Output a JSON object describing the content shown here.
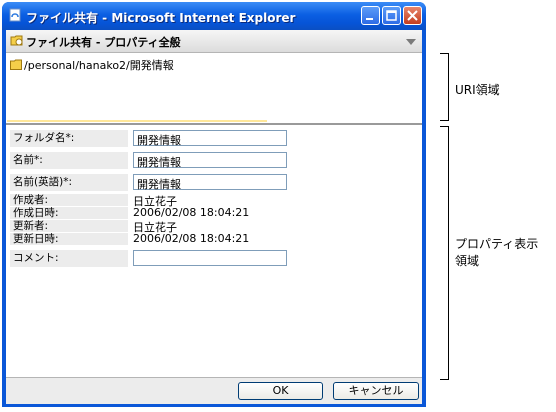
{
  "window": {
    "title": "ファイル共有 - Microsoft Internet Explorer"
  },
  "header": {
    "title": "ファイル共有 - プロパティ全般"
  },
  "uri": {
    "path": "/personal/hanako2/開発情報"
  },
  "properties": {
    "folder_name": {
      "label": "フォルダ名*:",
      "value": "開発情報"
    },
    "name": {
      "label": "名前*:",
      "value": "開発情報"
    },
    "name_en": {
      "label": "名前(英語)*:",
      "value": "開発情報"
    },
    "creator": {
      "label": "作成者:",
      "value": "日立花子"
    },
    "created": {
      "label": "作成日時:",
      "value": "2006/02/08 18:04:21"
    },
    "updater": {
      "label": "更新者:",
      "value": "日立花子"
    },
    "updated": {
      "label": "更新日時:",
      "value": "2006/02/08 18:04:21"
    },
    "comment": {
      "label": "コメント:",
      "value": ""
    }
  },
  "buttons": {
    "ok": "OK",
    "cancel": "キャンセル"
  },
  "annotations": {
    "uri_area": "URI領域",
    "property_area_line1": "プロパティ表示",
    "property_area_line2": "領域"
  },
  "colors": {
    "titlebar": "#0b5fe3",
    "label_bg": "#ececec",
    "input_border": "#7f9db9"
  }
}
